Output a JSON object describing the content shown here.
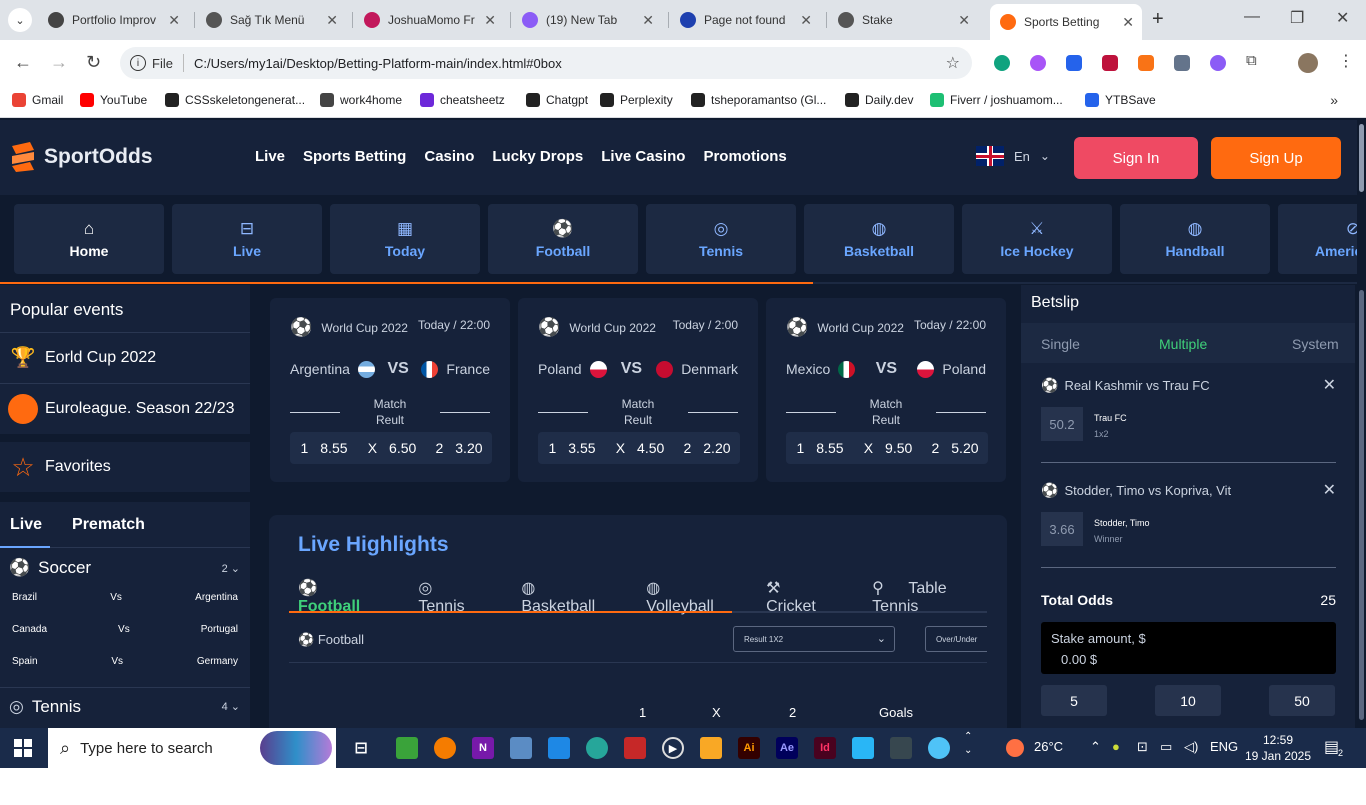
{
  "browser": {
    "tabs": [
      {
        "title": "Portfolio Improv",
        "color": "#444"
      },
      {
        "title": "Sağ Tık Menü",
        "color": "#555"
      },
      {
        "title": "JoshuaMomo Fr",
        "color": "#c2185b"
      },
      {
        "title": "(19) New Tab",
        "color": "#8b5cf6"
      },
      {
        "title": "Page not found",
        "color": "#1e40af"
      },
      {
        "title": "Stake",
        "color": "#555"
      },
      {
        "title": "Sports Betting",
        "color": "#ff6a10"
      }
    ],
    "address": {
      "scheme_label": "File",
      "url": "C:/Users/my1ai/Desktop/Betting-Platform-main/index.html#0box"
    },
    "bookmarks": [
      "Gmail",
      "YouTube",
      "CSSskeletongenerat...",
      "work4home",
      "cheatsheetz",
      "Chatgpt",
      "Perplexity",
      "tsheporamantso (Gl...",
      "Daily.dev",
      "Fiverr / joshuamom...",
      "YTBSave"
    ]
  },
  "site": {
    "brand": "SportOdds",
    "nav": [
      "Live",
      "Sports Betting",
      "Casino",
      "Lucky Drops",
      "Live Casino",
      "Promotions"
    ],
    "lang": "En",
    "signin": "Sign In",
    "signup": "Sign Up",
    "categories": [
      {
        "label": "Home",
        "icon": "⌂"
      },
      {
        "label": "Live",
        "icon": "⊟"
      },
      {
        "label": "Today",
        "icon": "▦"
      },
      {
        "label": "Football",
        "icon": "⚽"
      },
      {
        "label": "Tennis",
        "icon": "◎"
      },
      {
        "label": "Basketball",
        "icon": "◍"
      },
      {
        "label": "Ice Hockey",
        "icon": "⚔"
      },
      {
        "label": "Handball",
        "icon": "◍"
      },
      {
        "label": "American F",
        "icon": "⊘"
      }
    ],
    "category_progress": 0.595,
    "sidebar": {
      "title": "Popular events",
      "events": [
        "Eorld Cup 2022",
        "Euroleague. Season 22/23"
      ],
      "favorites": "Favorites",
      "tabs": [
        "Live",
        "Prematch"
      ],
      "sports": [
        {
          "name": "Soccer",
          "count": "2",
          "matches": [
            {
              "home": "Brazil",
              "vs": "Vs",
              "away": "Argentina"
            },
            {
              "home": "Canada",
              "vs": "Vs",
              "away": "Portugal"
            },
            {
              "home": "Spain",
              "vs": "Vs",
              "away": "Germany"
            }
          ]
        },
        {
          "name": "Tennis",
          "count": "4",
          "matches": []
        }
      ]
    },
    "match_cards": [
      {
        "league": "World Cup 2022",
        "date": "Today / 22:00",
        "home": "Argentina",
        "away": "France",
        "vs": "VS",
        "result_label": "Match Reult",
        "odds": [
          {
            "k": "1",
            "v": "8.55"
          },
          {
            "k": "X",
            "v": "6.50"
          },
          {
            "k": "2",
            "v": "3.20"
          }
        ]
      },
      {
        "league": "World Cup 2022",
        "date": "Today / 2:00",
        "home": "Poland",
        "away": "Denmark",
        "vs": "VS",
        "result_label": "Match Reult",
        "odds": [
          {
            "k": "1",
            "v": "3.55"
          },
          {
            "k": "X",
            "v": "4.50"
          },
          {
            "k": "2",
            "v": "2.20"
          }
        ]
      },
      {
        "league": "World Cup 2022",
        "date": "Today / 22:00",
        "home": "Mexico",
        "away": "Poland",
        "vs": "VS",
        "result_label": "Match Reult",
        "odds": [
          {
            "k": "1",
            "v": "8.55"
          },
          {
            "k": "X",
            "v": "9.50"
          },
          {
            "k": "2",
            "v": "5.20"
          }
        ]
      }
    ],
    "live_highlights": {
      "title": "Live Highlights",
      "sports": [
        "Football",
        "Tennis",
        "Basketball",
        "Volleyball",
        "Cricket",
        "Table Tennis"
      ],
      "sub_sport": "Football",
      "market_select": "Result 1X2",
      "market_select2": "Over/Under",
      "columns": [
        "1",
        "X",
        "2",
        "Goals"
      ],
      "progress": 0.635
    },
    "betslip": {
      "title": "Betslip",
      "tabs": [
        "Single",
        "Multiple",
        "System"
      ],
      "items": [
        {
          "match": "Real Kashmir vs Trau FC",
          "odd": "50.2",
          "pick": "Trau FC",
          "market": "1x2"
        },
        {
          "match": "Stodder, Timo vs Kopriva, Vit",
          "odd": "3.66",
          "pick": "Stodder, Timo",
          "market": "Winner"
        }
      ],
      "total_label": "Total Odds",
      "total_value": "25",
      "stake_label": "Stake amount, $",
      "stake_value": "0.00 $",
      "quick": [
        "5",
        "10",
        "50"
      ]
    }
  },
  "taskbar": {
    "search_placeholder": "Type here to search",
    "weather": "26°C",
    "lang": "ENG",
    "time": "12:59",
    "date": "19 Jan 2025",
    "notifications": "2"
  }
}
